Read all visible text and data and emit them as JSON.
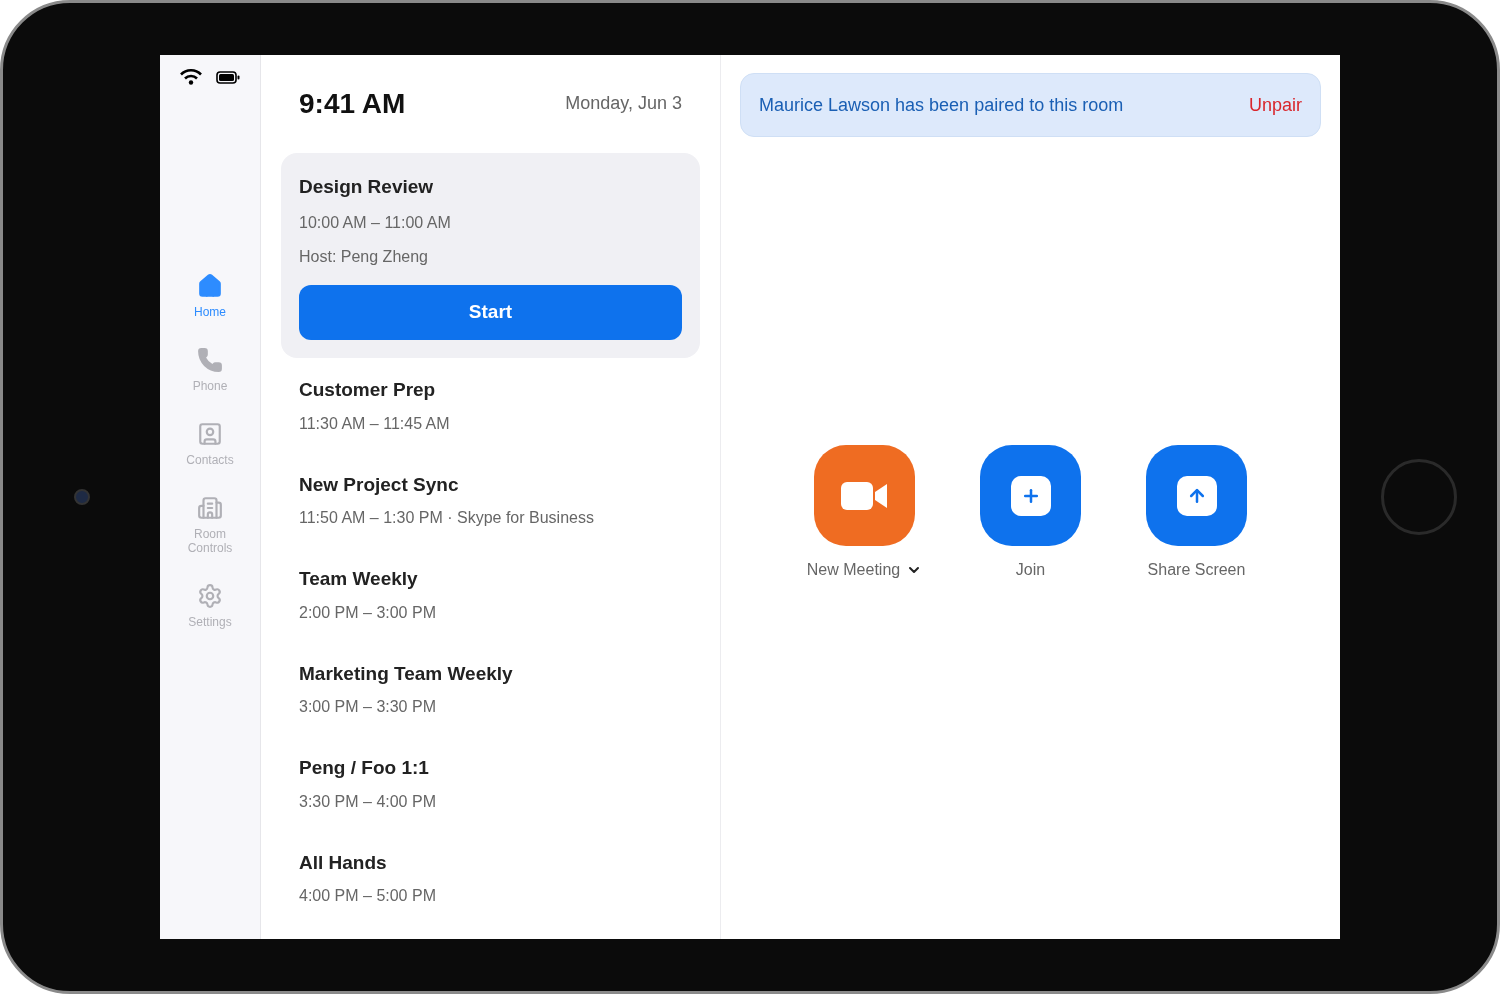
{
  "nav": [
    {
      "label": "Home",
      "kind": "home",
      "selected": true
    },
    {
      "label": "Phone",
      "kind": "phone",
      "selected": false
    },
    {
      "label": "Contacts",
      "kind": "contacts",
      "selected": false
    },
    {
      "label": "Room\nControls",
      "kind": "room",
      "selected": false
    },
    {
      "label": "Settings",
      "kind": "settings",
      "selected": false
    }
  ],
  "header": {
    "time": "9:41 AM",
    "date": "Monday, Jun 3"
  },
  "meetings": [
    {
      "kind": "featured",
      "title": "Design Review",
      "time": "10:00 AM – 11:00 AM",
      "host": "Host: Peng Zheng",
      "action": "Start"
    },
    {
      "kind": "plain",
      "title": "Customer Prep",
      "time": "11:30 AM – 11:45 AM"
    },
    {
      "kind": "plain",
      "title": "New Project Sync",
      "time": "11:50 AM – 1:30 PM · Skype for Business"
    },
    {
      "kind": "plain",
      "title": "Team Weekly",
      "time": "2:00 PM – 3:00 PM"
    },
    {
      "kind": "plain",
      "title": "Marketing Team Weekly",
      "time": "3:00 PM – 3:30 PM"
    },
    {
      "kind": "plain",
      "title": "Peng / Foo 1:1",
      "time": "3:30 PM – 4:00 PM"
    },
    {
      "kind": "plain",
      "title": "All Hands",
      "time": "4:00 PM – 5:00 PM"
    }
  ],
  "banner": {
    "message": "Maurice Lawson has been paired to this room",
    "action": "Unpair"
  },
  "actions": [
    {
      "kind": "video",
      "label": "New Meeting",
      "color": "#ef6c22",
      "has_menu": true
    },
    {
      "kind": "join",
      "label": "Join",
      "color": "#0e72ed",
      "has_menu": false
    },
    {
      "kind": "share",
      "label": "Share Screen",
      "color": "#0e72ed",
      "has_menu": false
    }
  ]
}
